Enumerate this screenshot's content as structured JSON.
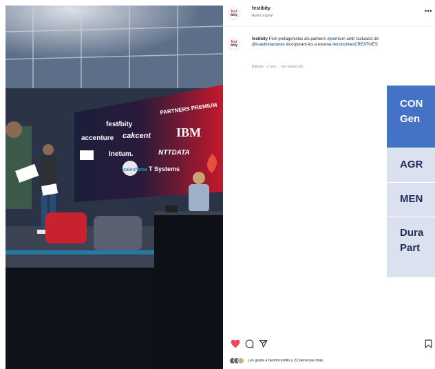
{
  "post": {
    "account": "festibity",
    "audio": "Audio original",
    "logo_top": "fest",
    "logo_bottom": "ibity",
    "caption_user": "festibity",
    "caption_text": "Fem protagonistes als partners",
    "caption_tag1": "#premium",
    "caption_text2": "amb l'actuació de",
    "caption_mention": "@ruavimitaciones",
    "caption_text3": "incorporant-los a escena",
    "caption_tag2": "#economiesCREATIVES",
    "edited": "Editado · 2 sem",
    "translate": "Ver traducción",
    "likes_text": "Les gusta a benitocerrillo y 22 personas más"
  },
  "stage_screen": {
    "partners_label": "PARTNERS PREMIUM",
    "brand": "fest/bity",
    "logos": [
      "accenture",
      "cakcent",
      "IBM",
      "Inetum.",
      "NTTDATA",
      "T Systems",
      "salesforce"
    ]
  },
  "table": {
    "header": "CON\nGen",
    "rows": [
      "AGR",
      "MEN",
      "Dura\nPart"
    ]
  },
  "icons": {
    "more": "more-icon",
    "like": "heart-icon",
    "comment": "comment-icon",
    "share": "share-icon",
    "save": "bookmark-icon"
  },
  "colors": {
    "like": "#ed4956",
    "table_header": "#4472c4",
    "table_row": "#dce1f0"
  }
}
